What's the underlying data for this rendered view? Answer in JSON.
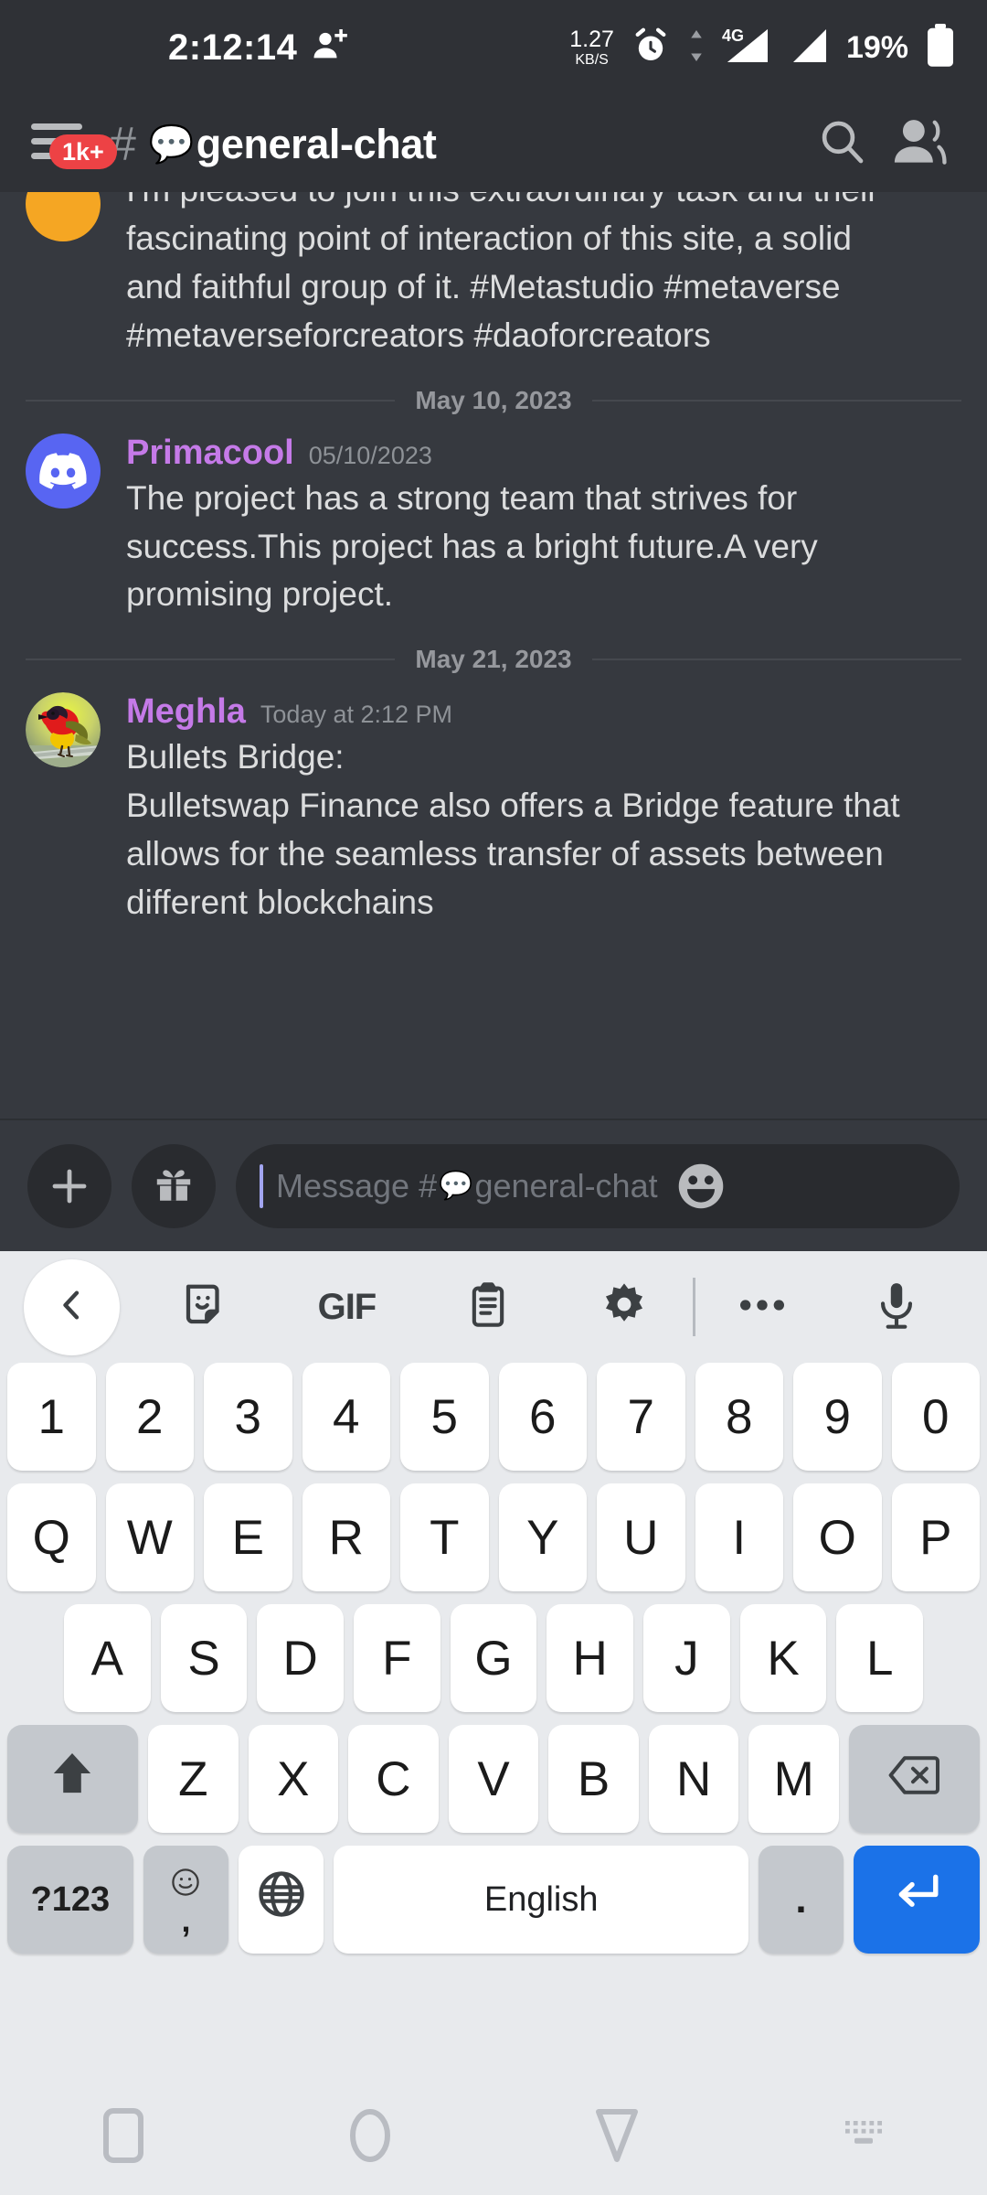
{
  "statusbar": {
    "clock": "2:12:14",
    "add_person_icon": "person-add-icon",
    "net_speed_value": "1.27",
    "net_speed_unit": "KB/S",
    "alarm_icon": "alarm-clock-icon",
    "network_label": "4G",
    "battery_percent": "19%",
    "battery_icon": "battery-icon"
  },
  "header": {
    "menu_badge": "1k+",
    "hash": "#",
    "channel_emoji": "💬",
    "channel_name": "general-chat",
    "search_icon": "search-icon",
    "members_icon": "members-icon"
  },
  "chat": {
    "partial_message": {
      "text_lines": [
        "I'm pleased to join this extraordinary task and their",
        "fascinating point of interaction of this site, a solid",
        "and faithful group of it.   #Metastudio #metaverse",
        "#metaverseforcreators #daoforcreators"
      ],
      "avatar_color": "#f5a623"
    },
    "dividers": {
      "first": "May 10, 2023",
      "second": "May 21, 2023"
    },
    "messages": [
      {
        "username": "Primacool",
        "timestamp": "05/10/2023",
        "avatar": "discord-logo-avatar",
        "text_lines": [
          "The project has a strong team that strives for",
          "success.This project has a bright future.A very",
          "promising project."
        ]
      },
      {
        "username": "Meghla",
        "timestamp": "Today at 2:12 PM",
        "avatar": "bird-photo-avatar",
        "text_lines": [
          "Bullets Bridge:",
          "Bulletswap Finance also offers a Bridge feature that",
          "allows for the seamless transfer of assets between",
          "different blockchains"
        ]
      }
    ],
    "username_color": "#c57ae8"
  },
  "composer": {
    "add_label": "+",
    "gift_icon": "gift-icon",
    "placeholder_prefix": "Message #",
    "placeholder_emoji": "💬",
    "placeholder_channel": "general-chat",
    "emoji_icon": "emoji-smiley-icon"
  },
  "keyboard": {
    "toolbar": [
      {
        "name": "back-chevron-icon",
        "label": ""
      },
      {
        "name": "sticker-icon",
        "label": ""
      },
      {
        "name": "gif-icon",
        "label": "GIF"
      },
      {
        "name": "clipboard-icon",
        "label": ""
      },
      {
        "name": "settings-gear-icon",
        "label": ""
      },
      {
        "name": "more-options-icon",
        "label": ""
      },
      {
        "name": "microphone-icon",
        "label": ""
      }
    ],
    "rows": {
      "numbers": [
        "1",
        "2",
        "3",
        "4",
        "5",
        "6",
        "7",
        "8",
        "9",
        "0"
      ],
      "top": [
        "Q",
        "W",
        "E",
        "R",
        "T",
        "Y",
        "U",
        "I",
        "O",
        "P"
      ],
      "home": [
        "A",
        "S",
        "D",
        "F",
        "G",
        "H",
        "J",
        "K",
        "L"
      ],
      "bottom": [
        "Z",
        "X",
        "C",
        "V",
        "B",
        "N",
        "M"
      ]
    },
    "shift_icon": "shift-arrow-icon",
    "backspace_icon": "backspace-icon",
    "symbols_label": "?123",
    "comma_label": ",",
    "globe_icon": "globe-language-icon",
    "space_label": "English",
    "period_label": ".",
    "enter_icon": "enter-return-icon",
    "accent_color": "#1b72e8"
  },
  "navbar": {
    "recents_icon": "recents-square-icon",
    "home_icon": "home-circle-icon",
    "back_icon": "back-triangle-icon",
    "keyboard_icon": "hide-keyboard-icon"
  }
}
